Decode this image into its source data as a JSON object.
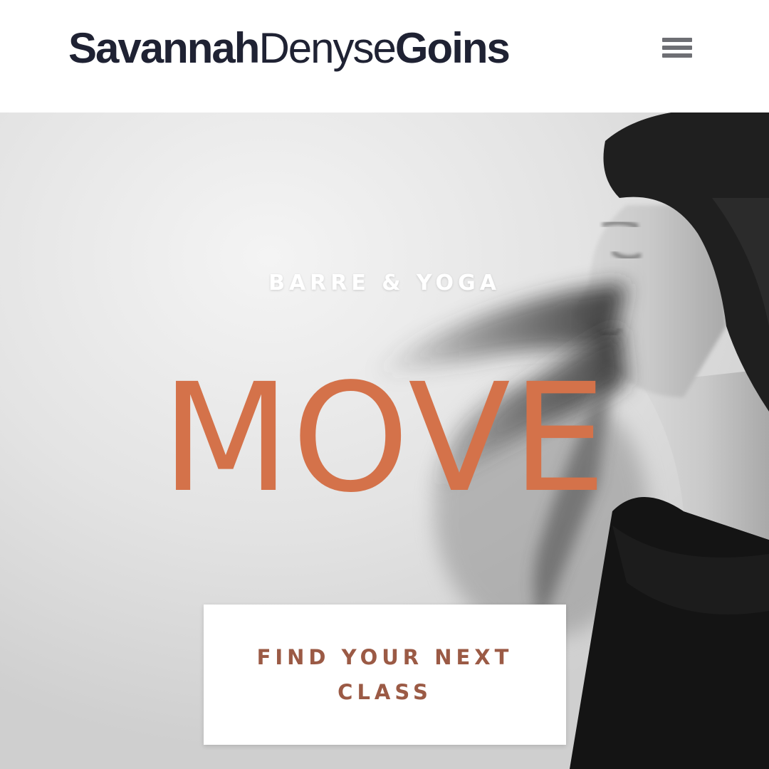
{
  "header": {
    "logo": {
      "part1": "Savannah",
      "part2": "Denyse",
      "part3": "Goins"
    },
    "menu_icon": "hamburger-menu-icon"
  },
  "hero": {
    "eyebrow": "BARRE & YOGA",
    "headline": "MOVE",
    "cta_label": "FIND YOUR NEXT CLASS",
    "photo": "woman-with-flowing-hair-photo"
  },
  "colors": {
    "logo_text": "#1f2233",
    "menu_icon": "#6e6f74",
    "headline": "#d4724a",
    "cta_text": "#9b5a45",
    "cta_background": "#ffffff"
  }
}
